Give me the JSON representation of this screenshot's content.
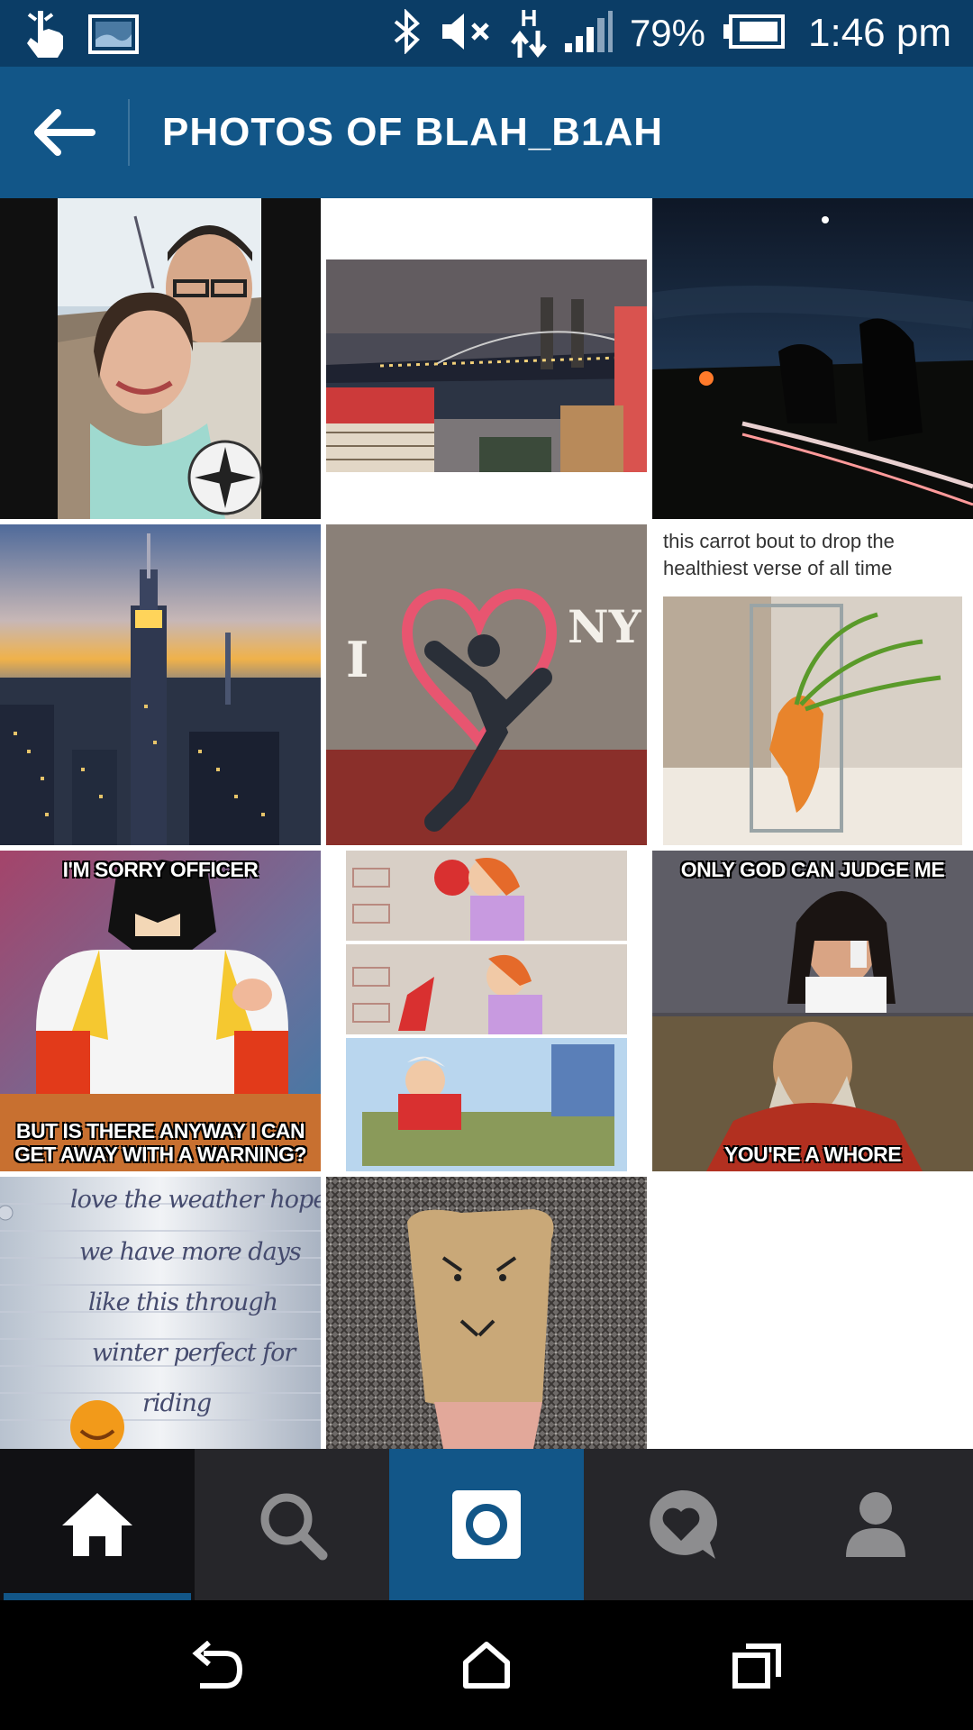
{
  "status_bar": {
    "battery_percent": "79%",
    "time": "1:46 pm",
    "network_type": "H",
    "icons": [
      "touch-icon",
      "gallery-icon",
      "bluetooth-icon",
      "mute-icon",
      "data-arrows-icon",
      "signal-icon",
      "battery-icon"
    ]
  },
  "header": {
    "title": "PHOTOS OF BLAH_B1AH"
  },
  "photos": {
    "tile3_caption_line1": "this carrot bout to drop the",
    "tile3_caption_line2": "healthiest verse of all time",
    "tile5_graffiti_left": "I",
    "tile5_graffiti_right": "NY",
    "tile7_top": "I'M SORRY OFFICER",
    "tile7_bottom_line1": "BUT IS THERE ANYWAY I CAN",
    "tile7_bottom_line2": "GET AWAY WITH A WARNING?",
    "tile9_top": "ONLY GOD CAN JUDGE ME",
    "tile9_bottom": "YOU'RE A WHORE",
    "tile10_line1": "love the weather hope",
    "tile10_line2": "we have more days",
    "tile10_line3": "like this through",
    "tile10_line4": "winter perfect for",
    "tile10_line5": "riding"
  },
  "bottom_nav": {
    "items": [
      {
        "icon": "home-icon",
        "active": true
      },
      {
        "icon": "search-icon",
        "active": false
      },
      {
        "icon": "camera-icon",
        "active": false
      },
      {
        "icon": "activity-heart-icon",
        "active": false
      },
      {
        "icon": "profile-icon",
        "active": false
      }
    ]
  },
  "colors": {
    "status_bar": "#0b3d66",
    "app_bar": "#125688",
    "nav_bg": "#26262a",
    "nav_active": "#111114",
    "accent": "#125688"
  }
}
